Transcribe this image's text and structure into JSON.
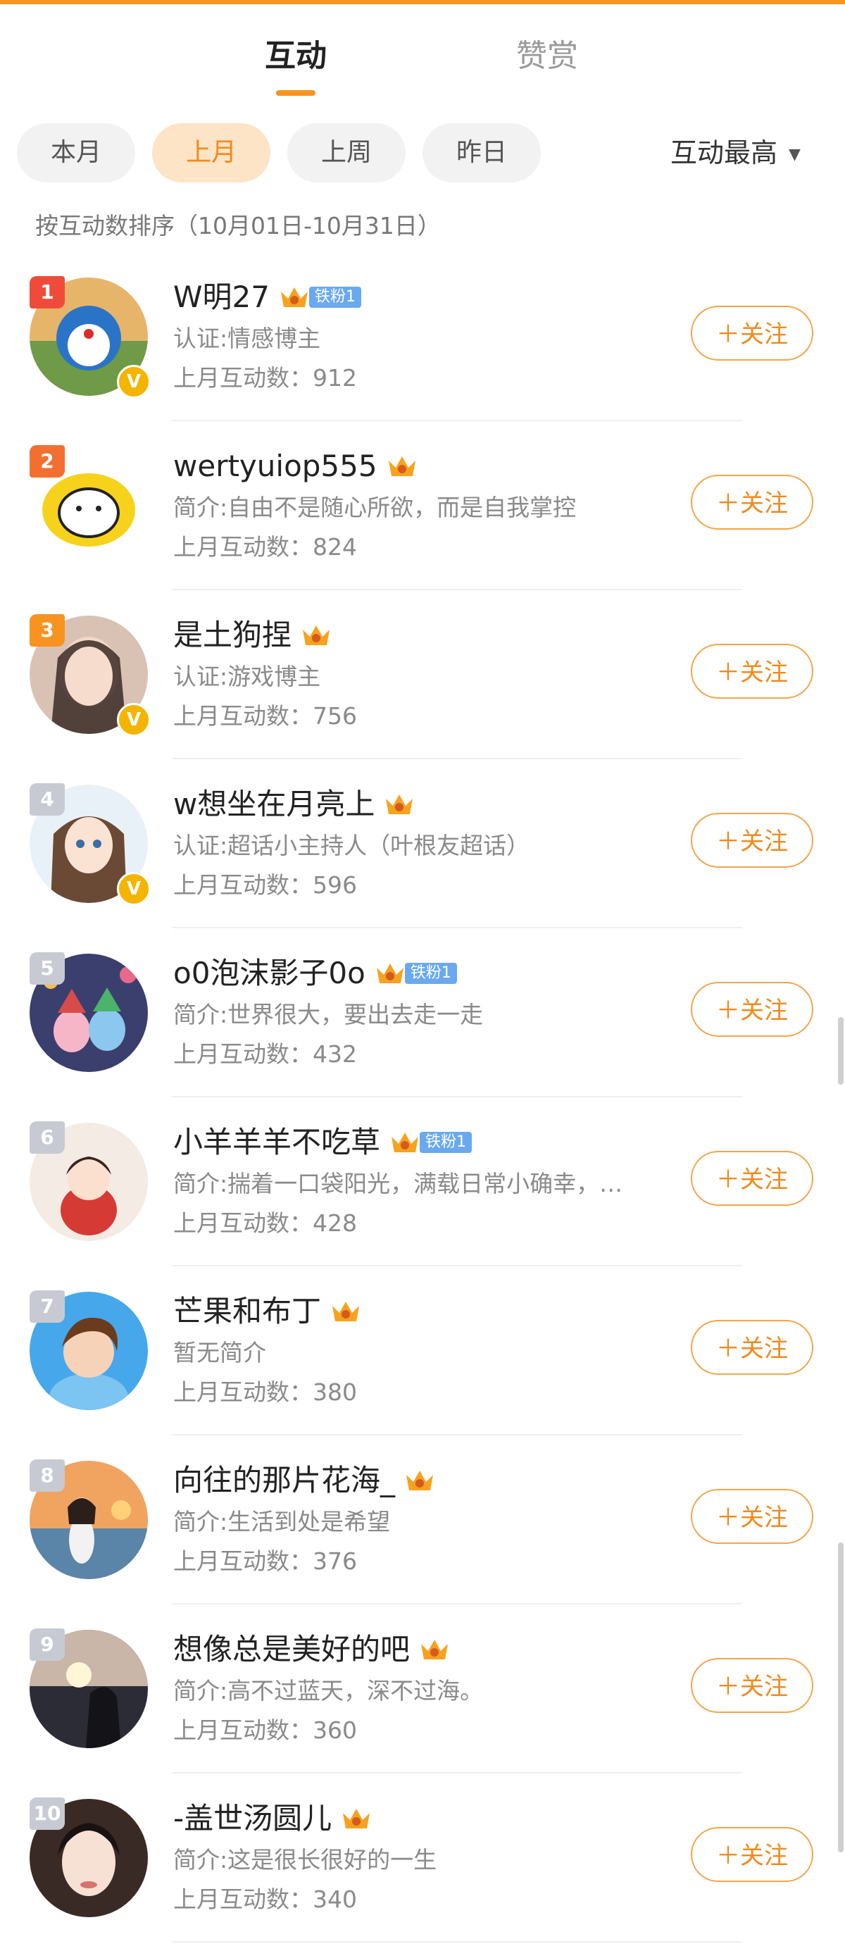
{
  "tabs": {
    "interaction": "互动",
    "appreciation": "赞赏"
  },
  "filters": {
    "chips": [
      "本月",
      "上月",
      "上周",
      "昨日"
    ],
    "selected": "上月",
    "sort_label": "互动最高",
    "caret": "▼"
  },
  "subline": "按互动数排序（10月01日-10月31日）",
  "follow_label": "＋关注",
  "users": [
    {
      "rank": "1",
      "name": "W明27",
      "fan_badge": "铁粉1",
      "verified": true,
      "desc": "认证:情感博主",
      "count": "上月互动数：912"
    },
    {
      "rank": "2",
      "name": "wertyuiop555",
      "fan_badge": "",
      "verified": false,
      "desc": "简介:自由不是随心所欲，而是自我掌控",
      "count": "上月互动数：824"
    },
    {
      "rank": "3",
      "name": "是土狗捏",
      "fan_badge": "",
      "verified": true,
      "desc": "认证:游戏博主",
      "count": "上月互动数：756"
    },
    {
      "rank": "4",
      "name": "w想坐在月亮上",
      "fan_badge": "",
      "verified": true,
      "desc": "认证:超话小主持人（叶根友超话）",
      "count": "上月互动数：596"
    },
    {
      "rank": "5",
      "name": "o0泡沫影子0o",
      "fan_badge": "铁粉1",
      "verified": false,
      "desc": "简介:世界很大，要出去走一走",
      "count": "上月互动数：432"
    },
    {
      "rank": "6",
      "name": "小羊羊羊不吃草",
      "fan_badge": "铁粉1",
      "verified": false,
      "desc": "简介:揣着一口袋阳光，满载日常小确幸，…",
      "count": "上月互动数：428"
    },
    {
      "rank": "7",
      "name": "芒果和布丁",
      "fan_badge": "",
      "verified": false,
      "desc": "暂无简介",
      "count": "上月互动数：380"
    },
    {
      "rank": "8",
      "name": "向往的那片花海_",
      "fan_badge": "",
      "verified": false,
      "desc": "简介:生活到处是希望",
      "count": "上月互动数：376"
    },
    {
      "rank": "9",
      "name": "想像总是美好的吧",
      "fan_badge": "",
      "verified": false,
      "desc": "简介:高不过蓝天，深不过海。",
      "count": "上月互动数：360"
    },
    {
      "rank": "10",
      "name": "-盖世汤圆儿",
      "fan_badge": "",
      "verified": false,
      "desc": "简介:这是很长很好的一生",
      "count": "上月互动数：340"
    }
  ],
  "colors": {
    "accent": "#f7931e",
    "rank1": "#f04b3a",
    "rank2": "#f36f30",
    "rank3": "#f7931e",
    "rank_other": "#c7cad3",
    "fan_badge": "#6aa9ef",
    "verified": "#f5b400"
  }
}
